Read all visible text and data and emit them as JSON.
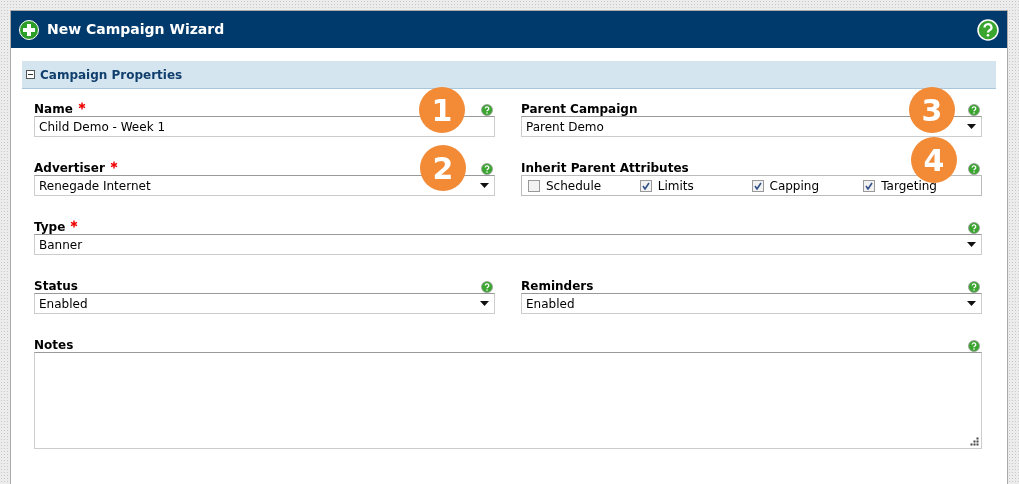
{
  "window": {
    "title": "New Campaign Wizard"
  },
  "section": {
    "title": "Campaign Properties",
    "expanded": true
  },
  "rows": [
    {
      "fields": [
        {
          "kind": "text",
          "label": "Name",
          "required": true,
          "value": "Child Demo - Week 1"
        },
        {
          "kind": "select",
          "label": "Parent Campaign",
          "required": false,
          "value": "Parent Demo"
        }
      ]
    },
    {
      "fields": [
        {
          "kind": "select",
          "label": "Advertiser",
          "required": true,
          "value": "Renegade Internet"
        },
        {
          "kind": "checkboxes",
          "label": "Inherit Parent Attributes",
          "required": false,
          "options": [
            {
              "label": "Schedule",
              "checked": false
            },
            {
              "label": "Limits",
              "checked": true
            },
            {
              "label": "Capping",
              "checked": true
            },
            {
              "label": "Targeting",
              "checked": true
            }
          ]
        }
      ]
    },
    {
      "fields": [
        {
          "kind": "select",
          "label": "Type",
          "required": true,
          "value": "Banner"
        }
      ]
    },
    {
      "fields": [
        {
          "kind": "select",
          "label": "Status",
          "required": false,
          "value": "Enabled"
        },
        {
          "kind": "select",
          "label": "Reminders",
          "required": false,
          "value": "Enabled"
        }
      ]
    },
    {
      "fields": [
        {
          "kind": "textarea",
          "label": "Notes",
          "required": false
        }
      ]
    }
  ],
  "callouts": [
    "1",
    "2",
    "3",
    "4"
  ]
}
